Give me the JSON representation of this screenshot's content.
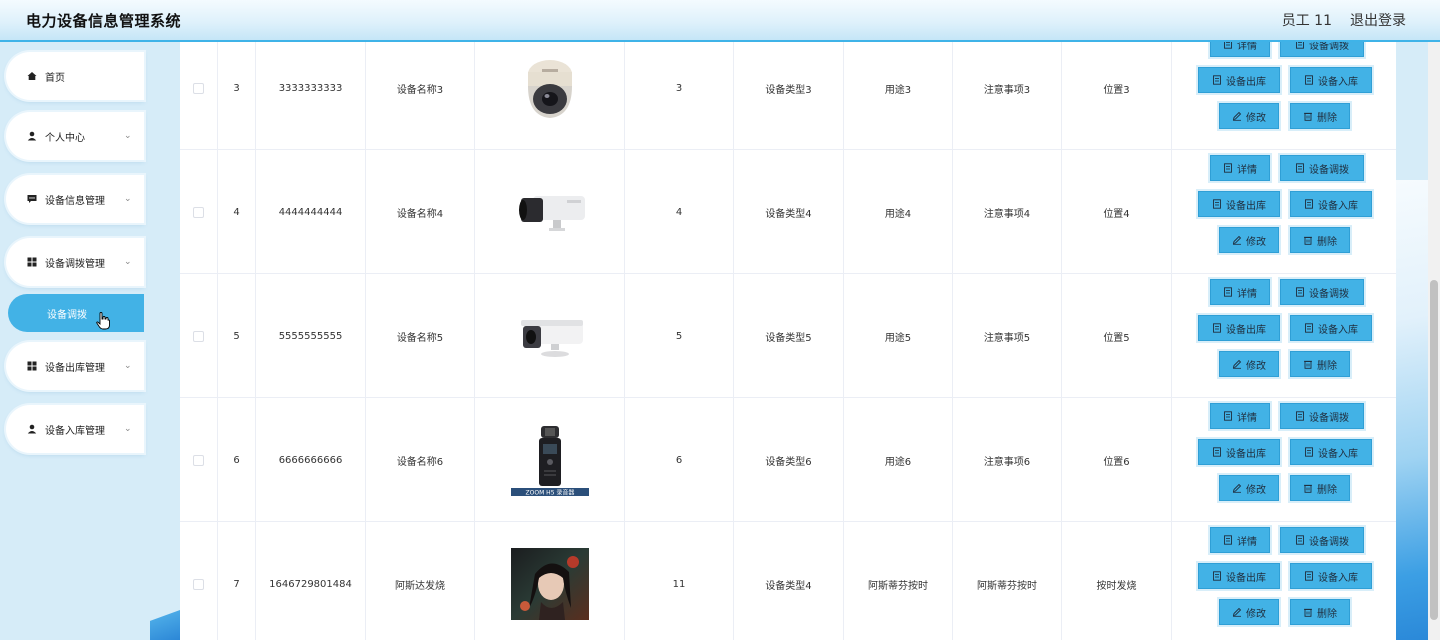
{
  "header": {
    "title": "电力设备信息管理系统",
    "user": "员工 11",
    "logout": "退出登录"
  },
  "sidebar": {
    "items": [
      {
        "label": "首页",
        "icon": "home-icon",
        "has_chevron": false
      },
      {
        "label": "个人中心",
        "icon": "user-icon",
        "has_chevron": true
      },
      {
        "label": "设备信息管理",
        "icon": "chat-icon",
        "has_chevron": true
      },
      {
        "label": "设备调拨管理",
        "icon": "grid-icon",
        "has_chevron": true
      },
      {
        "label": "设备出库管理",
        "icon": "grid-icon",
        "has_chevron": true
      },
      {
        "label": "设备入库管理",
        "icon": "user-icon",
        "has_chevron": true
      }
    ],
    "active_sub": "设备调拨"
  },
  "table": {
    "buttons": {
      "detail": "详情",
      "allocate": "设备调拨",
      "outbound": "设备出库",
      "inbound": "设备入库",
      "edit": "修改",
      "delete": "删除"
    },
    "rows": [
      {
        "index": "3",
        "code": "3333333333",
        "name": "设备名称3",
        "image": "dome-camera",
        "qty": "3",
        "type": "设备类型3",
        "use": "用途3",
        "note": "注意事项3",
        "location": "位置3"
      },
      {
        "index": "4",
        "code": "4444444444",
        "name": "设备名称4",
        "image": "bullet-camera-black",
        "qty": "4",
        "type": "设备类型4",
        "use": "用途4",
        "note": "注意事项4",
        "location": "位置4"
      },
      {
        "index": "5",
        "code": "5555555555",
        "name": "设备名称5",
        "image": "bullet-camera-white",
        "qty": "5",
        "type": "设备类型5",
        "use": "用途5",
        "note": "注意事项5",
        "location": "位置5"
      },
      {
        "index": "6",
        "code": "6666666666",
        "name": "设备名称6",
        "image": "zoom-recorder",
        "image_caption": "ZOOM H5 录音器",
        "qty": "6",
        "type": "设备类型6",
        "use": "用途6",
        "note": "注意事项6",
        "location": "位置6"
      },
      {
        "index": "7",
        "code": "1646729801484",
        "name": "阿斯达发烧",
        "image": "portrait-photo",
        "qty": "11",
        "type": "设备类型4",
        "use": "阿斯蒂芬按时",
        "note": "阿斯蒂芬按时",
        "location": "按时发烧"
      }
    ]
  },
  "colors": {
    "accent": "#42b2e6",
    "header_border": "#3fb3e8",
    "sidebar_bg": "#d6ecf8"
  }
}
